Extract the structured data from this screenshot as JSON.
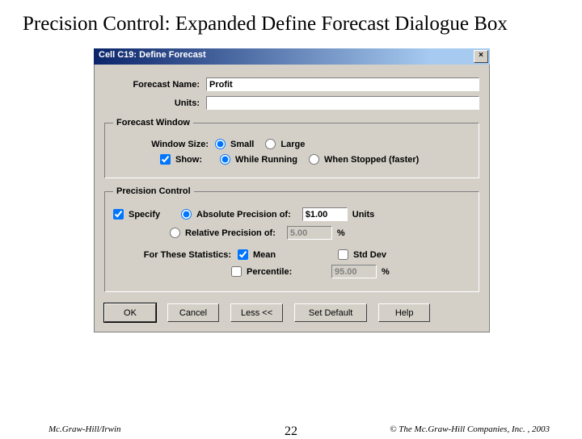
{
  "slide": {
    "title": "Precision Control: Expanded Define Forecast Dialogue Box",
    "page": "22",
    "footer_left": "Mc.Graw-Hill/Irwin",
    "footer_right": "© The Mc.Graw-Hill Companies, Inc. , 2003"
  },
  "dialog": {
    "title": "Cell C19: Define Forecast",
    "close": "×",
    "forecast_name_label": "Forecast Name:",
    "forecast_name_value": "Profit",
    "units_label": "Units:",
    "units_value": "",
    "fw": {
      "legend": "Forecast Window",
      "window_size_label": "Window Size:",
      "small": "Small",
      "large": "Large",
      "show_label": "Show:",
      "while_running": "While Running",
      "when_stopped": "When Stopped (faster)"
    },
    "pc": {
      "legend": "Precision Control",
      "specify": "Specify",
      "abs_label": "Absolute Precision of:",
      "abs_value": "$1.00",
      "abs_units": "Units",
      "rel_label": "Relative Precision of:",
      "rel_value": "5.00",
      "rel_units": "%",
      "for_stats": "For These Statistics:",
      "mean": "Mean",
      "stddev": "Std Dev",
      "percentile": "Percentile:",
      "percentile_value": "95.00",
      "percentile_units": "%"
    },
    "buttons": {
      "ok": "OK",
      "cancel": "Cancel",
      "less": "Less <<",
      "set_default": "Set Default",
      "help": "Help"
    }
  }
}
